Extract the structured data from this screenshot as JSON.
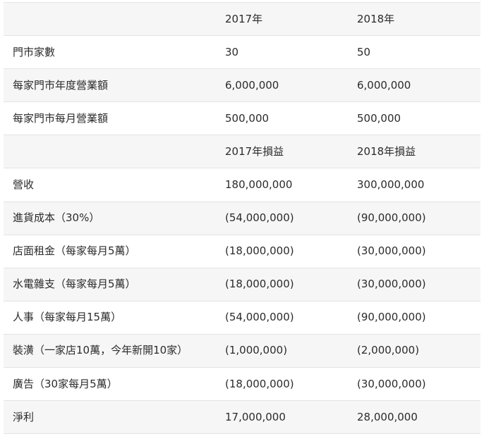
{
  "table": {
    "rows": [
      {
        "label": "",
        "y2017": "2017年",
        "y2018": "2018年"
      },
      {
        "label": "門市家數",
        "y2017": "30",
        "y2018": "50"
      },
      {
        "label": "每家門市年度營業額",
        "y2017": "6,000,000",
        "y2018": "6,000,000"
      },
      {
        "label": "每家門市每月營業額",
        "y2017": "500,000",
        "y2018": "500,000"
      },
      {
        "label": "",
        "y2017": "2017年損益",
        "y2018": "2018年損益"
      },
      {
        "label": "營收",
        "y2017": "180,000,000",
        "y2018": "300,000,000"
      },
      {
        "label": "進貨成本（30%）",
        "y2017": "(54,000,000)",
        "y2018": "(90,000,000)"
      },
      {
        "label": "店面租金（每家每月5萬）",
        "y2017": "(18,000,000)",
        "y2018": "(30,000,000)"
      },
      {
        "label": "水電雜支（每家每月5萬）",
        "y2017": "(18,000,000)",
        "y2018": "(30,000,000)"
      },
      {
        "label": "人事（每家每月15萬）",
        "y2017": "(54,000,000)",
        "y2018": "(90,000,000)"
      },
      {
        "label": "裝潢（一家店10萬，今年新開10家）",
        "y2017": "(1,000,000)",
        "y2018": "(2,000,000)"
      },
      {
        "label": "廣告（30家每月5萬）",
        "y2017": "(18,000,000)",
        "y2018": "(30,000,000)"
      },
      {
        "label": "淨利",
        "y2017": "17,000,000",
        "y2018": "28,000,000"
      }
    ]
  }
}
